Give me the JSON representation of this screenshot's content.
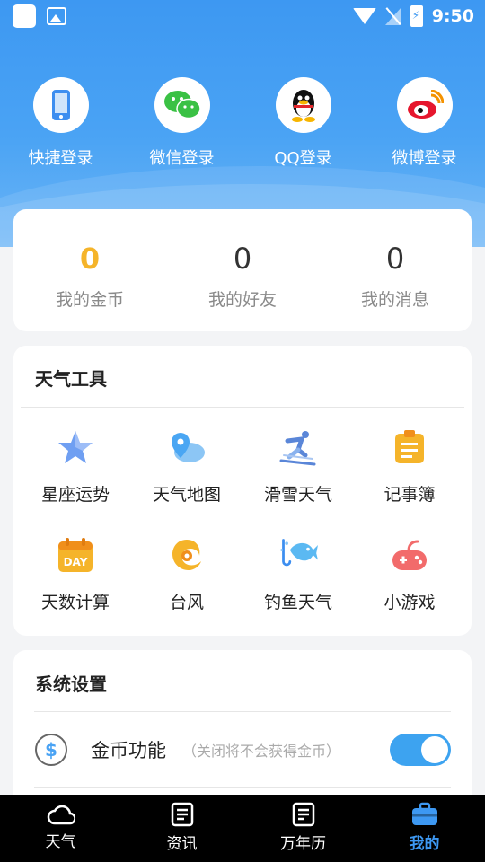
{
  "status_bar": {
    "time": "9:50"
  },
  "logins": [
    {
      "label": "快捷登录",
      "icon": "phone-icon"
    },
    {
      "label": "微信登录",
      "icon": "wechat-icon"
    },
    {
      "label": "QQ登录",
      "icon": "qq-penguin-icon"
    },
    {
      "label": "微博登录",
      "icon": "weibo-icon"
    }
  ],
  "stats": [
    {
      "value": "0",
      "label": "我的金币"
    },
    {
      "value": "0",
      "label": "我的好友"
    },
    {
      "value": "0",
      "label": "我的消息"
    }
  ],
  "tools": {
    "title": "天气工具",
    "items": [
      {
        "label": "星座运势",
        "icon": "star-icon"
      },
      {
        "label": "天气地图",
        "icon": "map-pin-cloud-icon"
      },
      {
        "label": "滑雪天气",
        "icon": "skier-icon"
      },
      {
        "label": "记事簿",
        "icon": "notepad-icon"
      },
      {
        "label": "天数计算",
        "icon": "calendar-day-icon"
      },
      {
        "label": "台风",
        "icon": "typhoon-icon"
      },
      {
        "label": "钓鱼天气",
        "icon": "fish-hook-icon"
      },
      {
        "label": "小游戏",
        "icon": "gamepad-icon"
      }
    ],
    "day_badge": "DAY"
  },
  "settings": {
    "title": "系统设置",
    "coin_row": {
      "name": "金币功能",
      "hint": "（关闭将不会获得金币）",
      "icon_glyph": "$",
      "enabled": true
    }
  },
  "tabs": [
    {
      "label": "天气",
      "icon": "cloud-icon",
      "active": false
    },
    {
      "label": "资讯",
      "icon": "news-icon",
      "active": false
    },
    {
      "label": "万年历",
      "icon": "calendar-doc-icon",
      "active": false
    },
    {
      "label": "我的",
      "icon": "briefcase-icon",
      "active": true
    }
  ],
  "colors": {
    "accent": "#3d98f2",
    "coin_gold": "#f5b42a",
    "toggle_on": "#3da3f0"
  }
}
